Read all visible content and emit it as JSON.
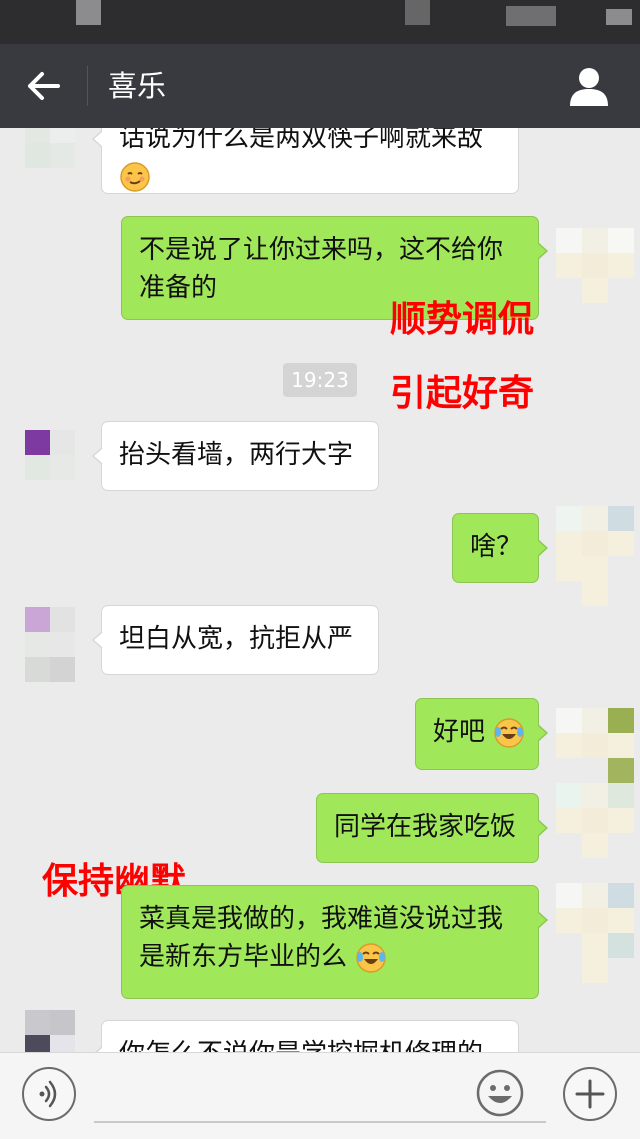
{
  "header": {
    "title": "喜乐"
  },
  "messages": {
    "m0": {
      "line1": "话说为什么是两双筷子啊就来敌",
      "line2": ""
    },
    "m1": {
      "line1": "不是说了让你过来吗，这不给你",
      "line2": "准备的"
    },
    "m2": {
      "text": "抬头看墙，两行大字"
    },
    "m3": {
      "text": "啥？"
    },
    "m4": {
      "text": "坦白从宽，抗拒从严"
    },
    "m5": {
      "text": "好吧"
    },
    "m6": {
      "text": "同学在我家吃饭"
    },
    "m7": {
      "line1": "菜真是我做的，我难道没说过我",
      "line2": "是新东方毕业的么"
    },
    "m8": {
      "text": "你怎么不说你是学挖掘机修理的"
    }
  },
  "timestamp": "19:23",
  "annotations": {
    "a1": "顺势调侃",
    "a2": "引起好奇",
    "a3": "保持幽默"
  },
  "input": {
    "value": ""
  },
  "icons": {
    "back": "arrow-left-icon",
    "profile": "person-icon",
    "voice": "voice-icon",
    "emoji": "smiley-icon",
    "plus": "plus-icon",
    "cry_laugh": "tears-of-joy-emoji",
    "smirk": "smirk-emoji"
  },
  "colors": {
    "topbar": "#393a3f",
    "background": "#ebebeb",
    "outgoing_bubble": "#a0e75a",
    "incoming_bubble": "#ffffff",
    "annotation": "#ff0000"
  }
}
